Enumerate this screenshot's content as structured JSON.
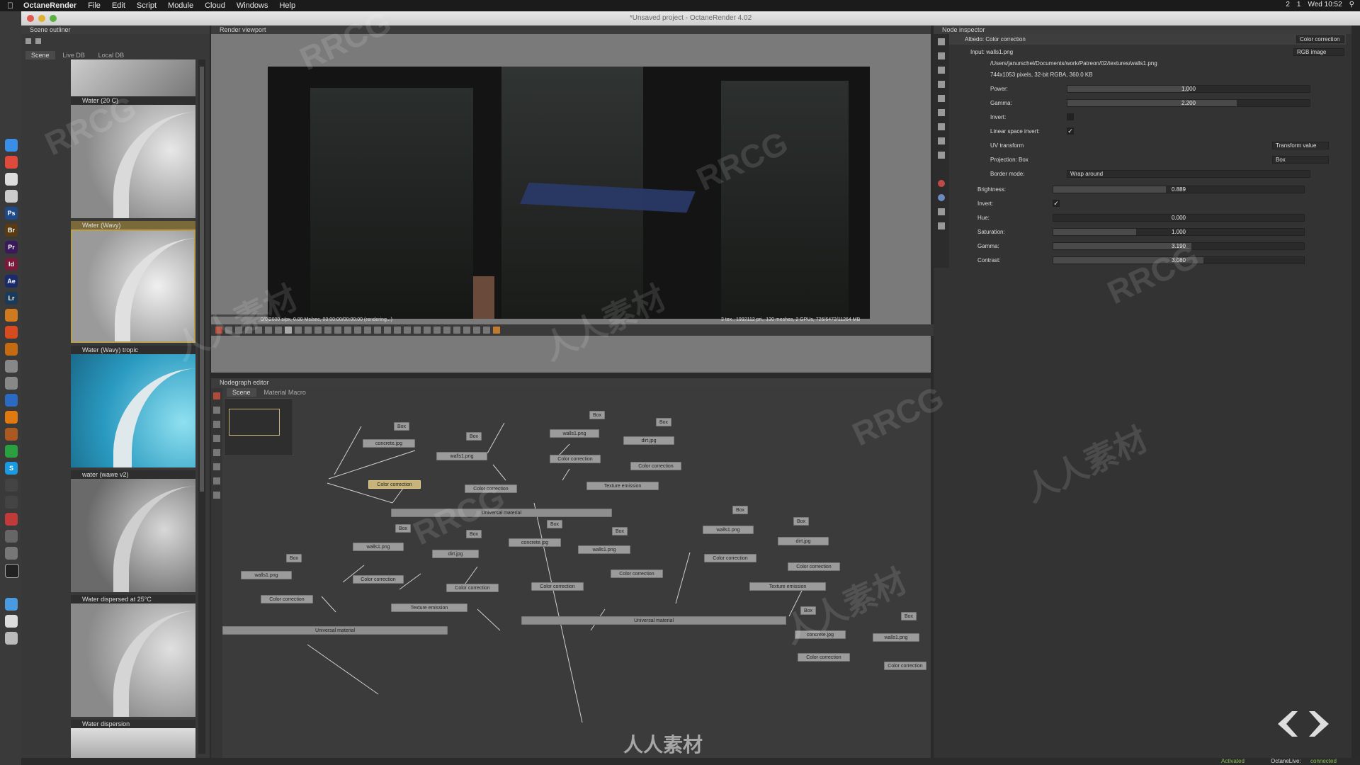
{
  "menubar": {
    "app": "OctaneRender",
    "items": [
      "File",
      "Edit",
      "Script",
      "Module",
      "Cloud",
      "Windows",
      "Help"
    ],
    "status": [
      "2",
      "1",
      "Wed 10:52"
    ]
  },
  "window": {
    "title": "*Unsaved project - OctaneRender 4.02"
  },
  "outliner": {
    "title": "Scene outliner",
    "tabs": [
      "Scene",
      "Live DB",
      "Local DB"
    ],
    "materials": [
      {
        "label": "Water (20 C)"
      },
      {
        "label": "Water (Wavy)"
      },
      {
        "label": "Water (Wavy) tropic"
      },
      {
        "label": "water (wawe v2)"
      },
      {
        "label": "Water dispersed at 25°C"
      },
      {
        "label": "Water dispersion"
      }
    ]
  },
  "viewport": {
    "title": "Render viewport",
    "status_left": "0/0/2000 s/px, 0.00 Ms/sec, 00:00:00/00:00:00 (rendering...)",
    "status_right": "3 tex., 1992112 pri., 130 meshes, 2 GPUs, 726/6472/11264 MB"
  },
  "nodegraph": {
    "title": "Nodegraph editor",
    "tabs": [
      "Scene",
      "Material Macro"
    ],
    "nodes": {
      "box": "Box",
      "concrete": "concrete.jpg",
      "walls": "walls1.png",
      "dirt": "dirt.jpg",
      "cc": "Color correction",
      "tex_emission": "Texture emission",
      "univ": "Universal material"
    }
  },
  "inspector": {
    "title": "Node inspector",
    "node_name": "Albedo: Color correction",
    "node_type": "Color correction",
    "input_label": "Input: walls1.png",
    "input_type": "RGB image",
    "file_path": "/Users/janurschel/Documents/work/Patreon/02/textures/walls1.png",
    "file_info": "744x1053 pixels, 32-bit RGBA, 360.0 KB",
    "inner": [
      {
        "label": "Power:",
        "value": "1.000",
        "fill": 0.5
      },
      {
        "label": "Gamma:",
        "value": "2.200",
        "fill": 0.7
      },
      {
        "label": "Invert:",
        "check": false
      },
      {
        "label": "Linear space invert:",
        "check": true
      },
      {
        "label": "UV transform",
        "dropdown": "Transform value"
      },
      {
        "label": "Projection: Box",
        "dropdown": "Box"
      },
      {
        "label": "Border mode:",
        "dropdown": "Wrap around"
      }
    ],
    "outer": [
      {
        "label": "Brightness:",
        "value": "0.889",
        "fill": 0.45
      },
      {
        "label": "Invert:",
        "check": true
      },
      {
        "label": "Hue:",
        "value": "0.000",
        "fill": 0.0
      },
      {
        "label": "Saturation:",
        "value": "1.000",
        "fill": 0.33
      },
      {
        "label": "Gamma:",
        "value": "3.190",
        "fill": 0.55
      },
      {
        "label": "Contrast:",
        "value": "3.080",
        "fill": 0.6
      }
    ]
  },
  "statusbar": {
    "activated": "Activated",
    "live_label": "OctaneLive:",
    "live_status": "connected"
  },
  "watermarks": [
    "RRCG",
    "人人素材"
  ]
}
